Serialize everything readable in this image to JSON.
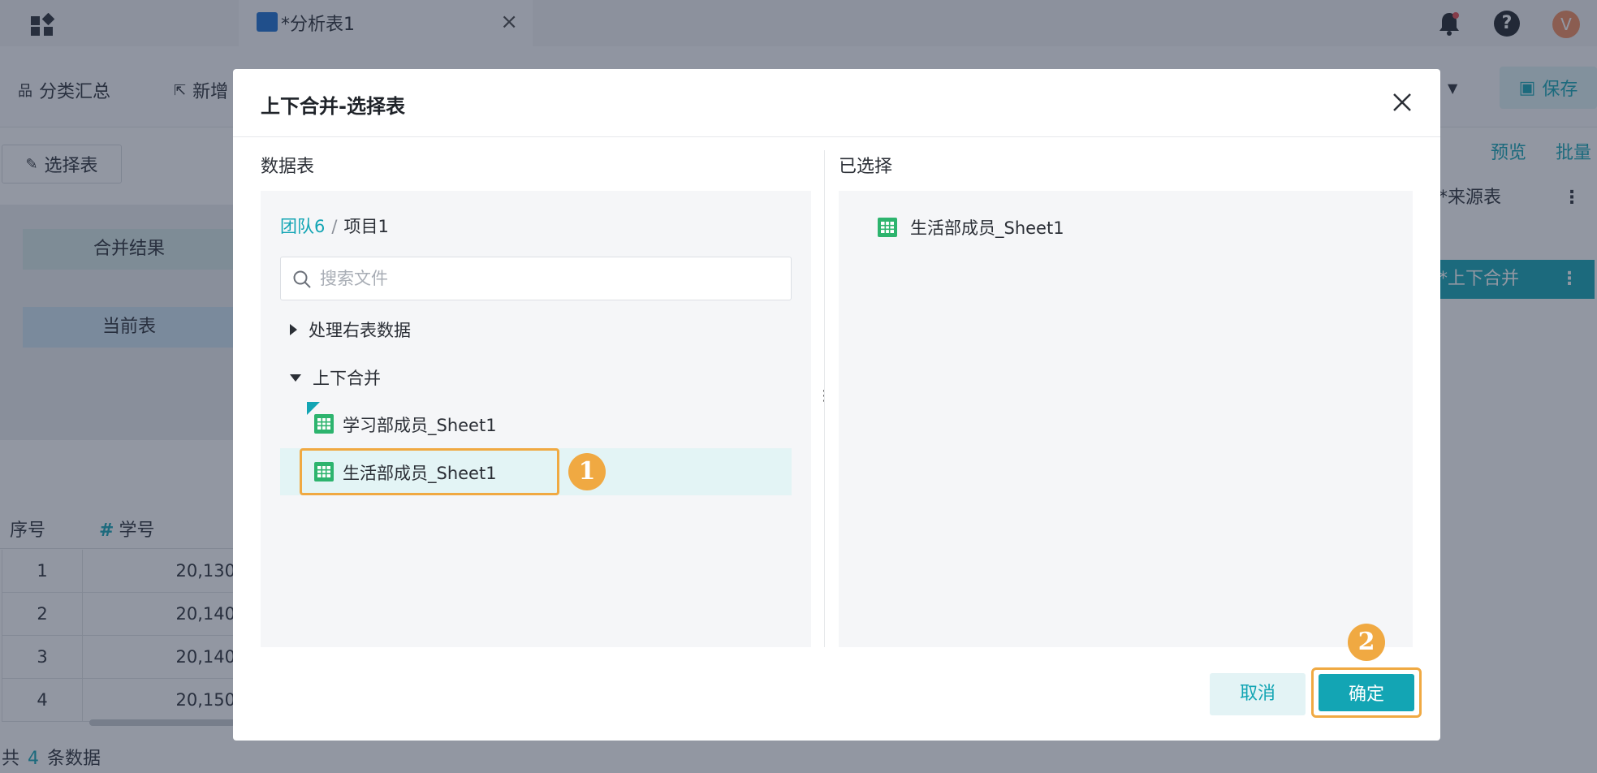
{
  "topbar": {
    "tab_title": "*分析表1",
    "tab_close": "×",
    "avatar_letter": "V",
    "help_glyph": "?"
  },
  "toolbar": {
    "items": [
      "分类汇总",
      "新增"
    ],
    "save_label": "保存"
  },
  "background": {
    "select_table_label": "选择表",
    "flow_nodes": [
      "合并结果",
      "当前表"
    ],
    "right_links": [
      "预览",
      "批量"
    ],
    "source_node": "*来源表",
    "merge_node": "*上下合并",
    "grid_headers": [
      "序号",
      "学号"
    ],
    "grid_rows": [
      {
        "seq": "1",
        "id": "20,130"
      },
      {
        "seq": "2",
        "id": "20,140"
      },
      {
        "seq": "3",
        "id": "20,140"
      },
      {
        "seq": "4",
        "id": "20,150"
      }
    ],
    "footer": {
      "prefix": "共",
      "count": "4",
      "suffix": "条数据"
    }
  },
  "modal": {
    "title": "上下合并-选择表",
    "left_title": "数据表",
    "right_title": "已选择",
    "breadcrumb": {
      "team": "团队6",
      "separator": "/",
      "project": "项目1"
    },
    "search_placeholder": "搜索文件",
    "tree": {
      "folders": [
        {
          "label": "处理右表数据",
          "expanded": false
        },
        {
          "label": "上下合并",
          "expanded": true
        }
      ],
      "files": [
        {
          "label": "学习部成员_Sheet1",
          "selected": false
        },
        {
          "label": "生活部成员_Sheet1",
          "selected": true
        }
      ]
    },
    "selected_items": [
      "生活部成员_Sheet1"
    ],
    "cancel_label": "取消",
    "confirm_label": "确定",
    "step_badges": [
      "1",
      "2"
    ]
  },
  "colors": {
    "accent": "#13a5b4",
    "highlight": "#f0a942",
    "sheet_icon": "#2db46e"
  }
}
